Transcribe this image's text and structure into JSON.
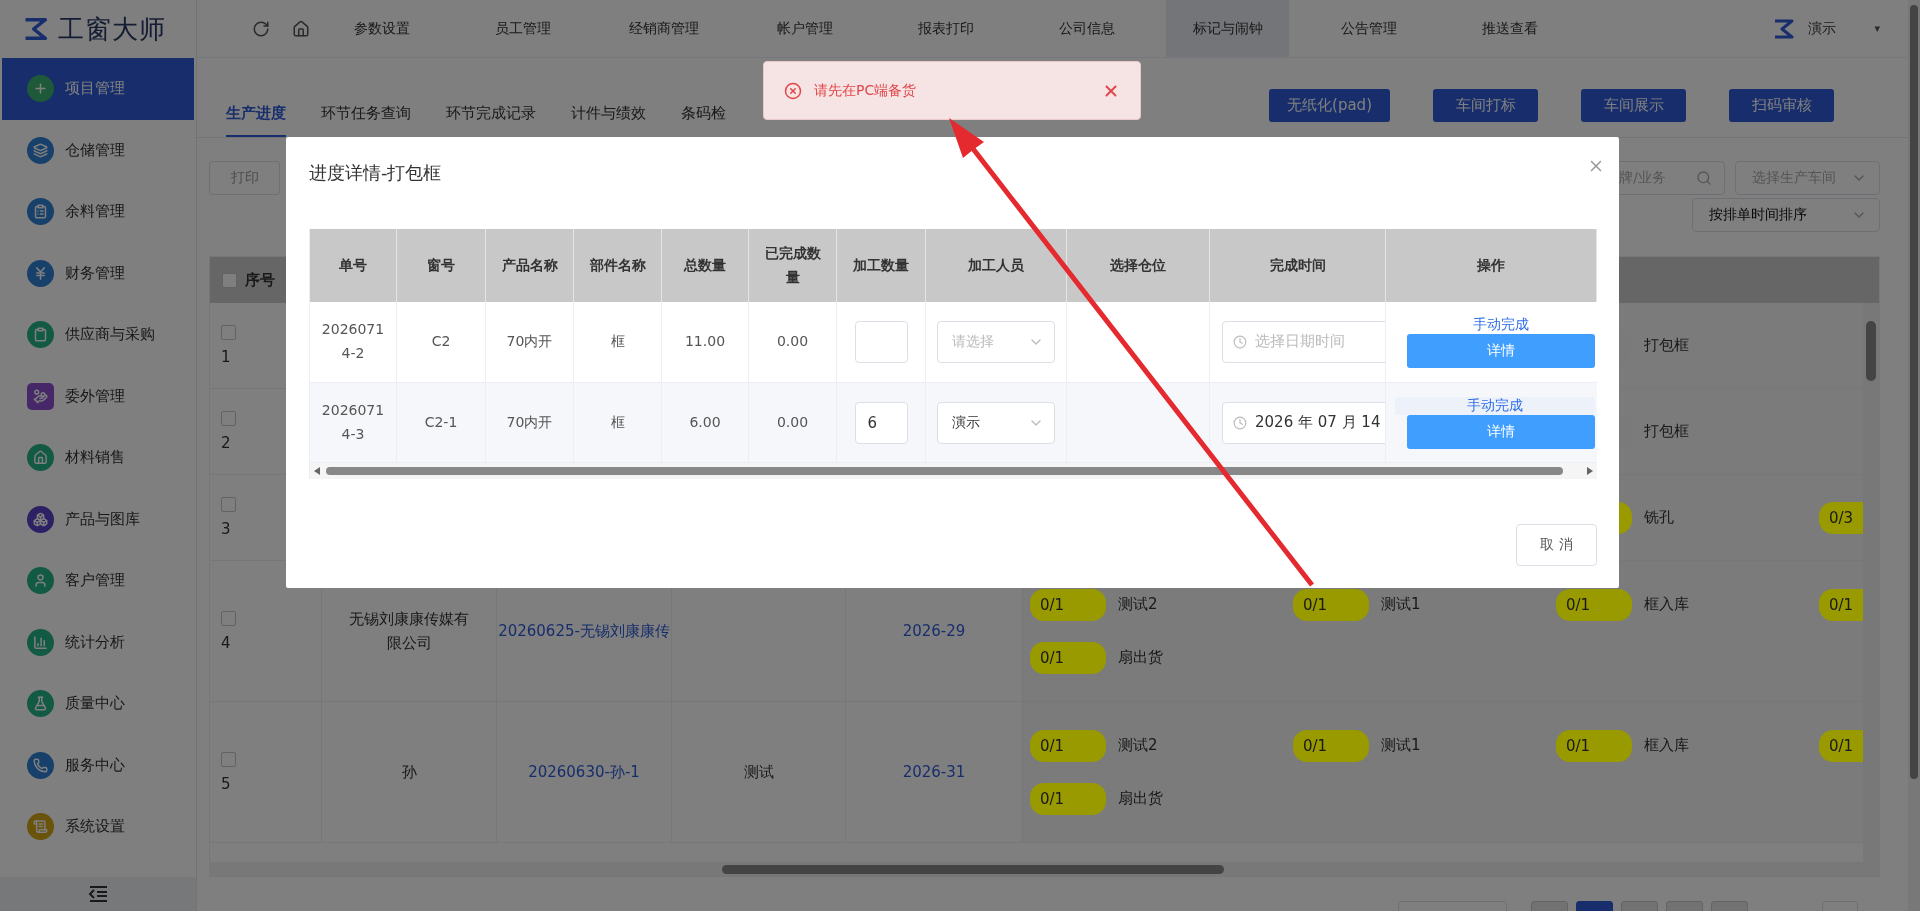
{
  "logo": {
    "text": "工窗大师"
  },
  "sidebar": {
    "items": [
      {
        "label": "项目管理",
        "selected": true,
        "color": "#1e5a39",
        "kind": "circle"
      },
      {
        "label": "仓储管理",
        "selected": false,
        "color": "#17406a",
        "kind": "circle"
      },
      {
        "label": "余料管理",
        "selected": false,
        "color": "#17406a",
        "kind": "circle"
      },
      {
        "label": "财务管理",
        "selected": false,
        "color": "#17406a",
        "kind": "circle"
      },
      {
        "label": "供应商与采购",
        "selected": false,
        "color": "#135a45",
        "kind": "circle"
      },
      {
        "label": "委外管理",
        "selected": false,
        "color": "#462869",
        "kind": "square"
      },
      {
        "label": "材料销售",
        "selected": false,
        "color": "#135a45",
        "kind": "circle"
      },
      {
        "label": "产品与图库",
        "selected": false,
        "color": "#2d2065",
        "kind": "circle"
      },
      {
        "label": "客户管理",
        "selected": false,
        "color": "#135a45",
        "kind": "circle"
      },
      {
        "label": "统计分析",
        "selected": false,
        "color": "#135a45",
        "kind": "circle"
      },
      {
        "label": "质量中心",
        "selected": false,
        "color": "#135a45",
        "kind": "circle"
      },
      {
        "label": "服务中心",
        "selected": false,
        "color": "#17406a",
        "kind": "circle"
      },
      {
        "label": "系统设置",
        "selected": false,
        "color": "#6a530a",
        "kind": "circle"
      }
    ]
  },
  "topnav": {
    "items": [
      {
        "label": "参数设置",
        "selected": false
      },
      {
        "label": "员工管理",
        "selected": false
      },
      {
        "label": "经销商管理",
        "selected": false
      },
      {
        "label": "帐户管理",
        "selected": false
      },
      {
        "label": "报表打印",
        "selected": false
      },
      {
        "label": "公司信息",
        "selected": false
      },
      {
        "label": "标记与闹钟",
        "selected": true
      },
      {
        "label": "公告管理",
        "selected": false
      },
      {
        "label": "推送查看",
        "selected": false
      }
    ],
    "user": {
      "name": "演示",
      "caret": "▾"
    }
  },
  "tabs": [
    {
      "label": "生产进度",
      "selected": true
    },
    {
      "label": "环节任务查询",
      "selected": false
    },
    {
      "label": "环节完成记录",
      "selected": false
    },
    {
      "label": "计件与绩效",
      "selected": false
    },
    {
      "label": "条码检",
      "selected": false
    }
  ],
  "actions": [
    "无纸化(pad)",
    "车间打标",
    "车间展示",
    "扫码审核"
  ],
  "toolbar": {
    "print": "打印",
    "search": {
      "placeholder": "牌/业务"
    },
    "workshop": {
      "placeholder": "选择生产车间"
    },
    "sort": {
      "value": "按排单时间排序"
    }
  },
  "table": {
    "header": {
      "column_1": "序号",
      "checked": false
    },
    "rows": [
      {
        "index": "1",
        "checked": false,
        "tags": [
          {
            "column_3": {
              "label": "打包框",
              "color": "#7a7a7a"
            }
          }
        ]
      },
      {
        "index": "2",
        "checked": false,
        "tags": [
          {
            "column_3": {
              "label": "打包框",
              "color": "#7a7a7a"
            }
          }
        ]
      },
      {
        "index": "3",
        "checked": false,
        "tags": [
          {
            "column_3": {
              "label": "铣孔",
              "color": "#999900"
            },
            "column_4": {
              "count": "0/3",
              "color": "#999900"
            }
          }
        ]
      },
      {
        "index": "4",
        "checked": false,
        "customer": "无锡刘康康传媒有限公司",
        "order": "20260625-无锡刘康康传",
        "column_5": "2026-29",
        "tags": [
          {
            "column_1": {
              "count": "0/1",
              "label": "测试2",
              "color": "#999900"
            },
            "column_2": {
              "count": "0/1",
              "label": "测试1",
              "color": "#999900"
            },
            "column_3": {
              "count": "0/1",
              "label": "框入库",
              "color": "#999900"
            },
            "column_4": {
              "count": "0/1",
              "color": "#999900"
            }
          },
          {
            "column_1": {
              "count": "0/1",
              "label": "扇出货",
              "color": "#999900"
            }
          }
        ]
      },
      {
        "index": "5",
        "checked": false,
        "customer": "孙",
        "order": "20260630-孙-1",
        "column_4": "测试",
        "column_5": "2026-31",
        "tags": [
          {
            "column_1": {
              "count": "0/1",
              "label": "测试2",
              "color": "#999900"
            },
            "column_2": {
              "count": "0/1",
              "label": "测试1",
              "color": "#999900"
            },
            "column_3": {
              "count": "0/1",
              "label": "框入库",
              "color": "#999900"
            },
            "column_4": {
              "count": "0/1",
              "color": "#999900"
            }
          },
          {
            "column_1": {
              "count": "0/1",
              "label": "扇出货",
              "color": "#999900"
            }
          }
        ]
      }
    ]
  },
  "pagination": {
    "pages": [
      {
        "selected": false
      },
      {
        "selected": true
      },
      {
        "selected": false
      },
      {
        "selected": false
      },
      {
        "selected": false
      }
    ]
  },
  "toast": {
    "message": "请先在PC端备货"
  },
  "modal": {
    "title": "进度详情-打包框",
    "columns": [
      "单号",
      "窗号",
      "产品名称",
      "部件名称",
      "总数量",
      "已完成数量",
      "加工数量",
      "加工人员",
      "选择仓位",
      "完成时间",
      "操作"
    ],
    "rows": [
      {
        "order_no": "20260714-2",
        "window": "C2",
        "product": "70内开",
        "part": "框",
        "total": "11.00",
        "done": "0.00",
        "worker": {
          "placeholder": "请选择"
        },
        "finish": {
          "placeholder": "选择日期时间"
        },
        "link": "手动完成",
        "button": "详情",
        "hovered": false
      },
      {
        "order_no": "20260714-3",
        "window": "C2-1",
        "product": "70内开",
        "part": "框",
        "total": "6.00",
        "done": "0.00",
        "quantity": "6",
        "worker": {
          "value": "演示"
        },
        "finish": {
          "value": "2026 年 07 月 14"
        },
        "link": "手动完成",
        "button": "详情",
        "hovered": true
      }
    ],
    "cancel": "取 消"
  }
}
